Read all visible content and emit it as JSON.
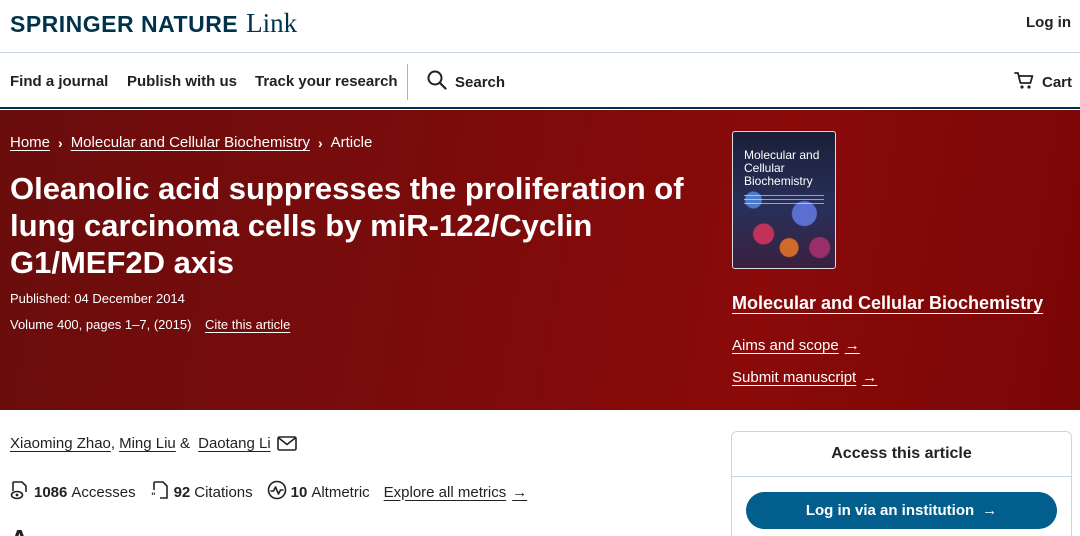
{
  "header": {
    "brand_main": "SPRINGER NATURE",
    "brand_link": "Link",
    "login": "Log in"
  },
  "nav": {
    "items": [
      {
        "label": "Find a journal"
      },
      {
        "label": "Publish with us"
      },
      {
        "label": "Track your research"
      }
    ],
    "search_label": "Search",
    "cart_label": "Cart"
  },
  "breadcrumb": {
    "items": [
      "Home",
      "Molecular and Cellular Biochemistry"
    ],
    "current": "Article"
  },
  "article": {
    "title": "Oleanolic acid suppresses the proliferation of lung carcinoma cells by miR-122/Cyclin G1/MEF2D axis",
    "published": "Published: 04 December 2014",
    "volume": "Volume 400, pages 1–7, (2015)",
    "cite_label": "Cite this article"
  },
  "journal": {
    "cover_title": "Molecular and Cellular Biochemistry",
    "name": "Molecular and Cellular Biochemistry",
    "aims_label": "Aims and scope",
    "submit_label": "Submit manuscript"
  },
  "authors": [
    "Xiaoming Zhao",
    "Ming Liu",
    "Daotang Li"
  ],
  "author_separators": [
    ", ",
    " & "
  ],
  "metrics": {
    "accesses_value": "1086",
    "accesses_label": "Accesses",
    "citations_value": "92",
    "citations_label": "Citations",
    "altmetric_value": "10",
    "altmetric_label": "Altmetric",
    "explore_label": "Explore all metrics"
  },
  "access": {
    "heading": "Access this article",
    "button_label": "Log in via an institution"
  },
  "colors": {
    "brand_navy": "#01324b",
    "hero_red": "#7d0b0b",
    "button_blue": "#025e8d"
  }
}
